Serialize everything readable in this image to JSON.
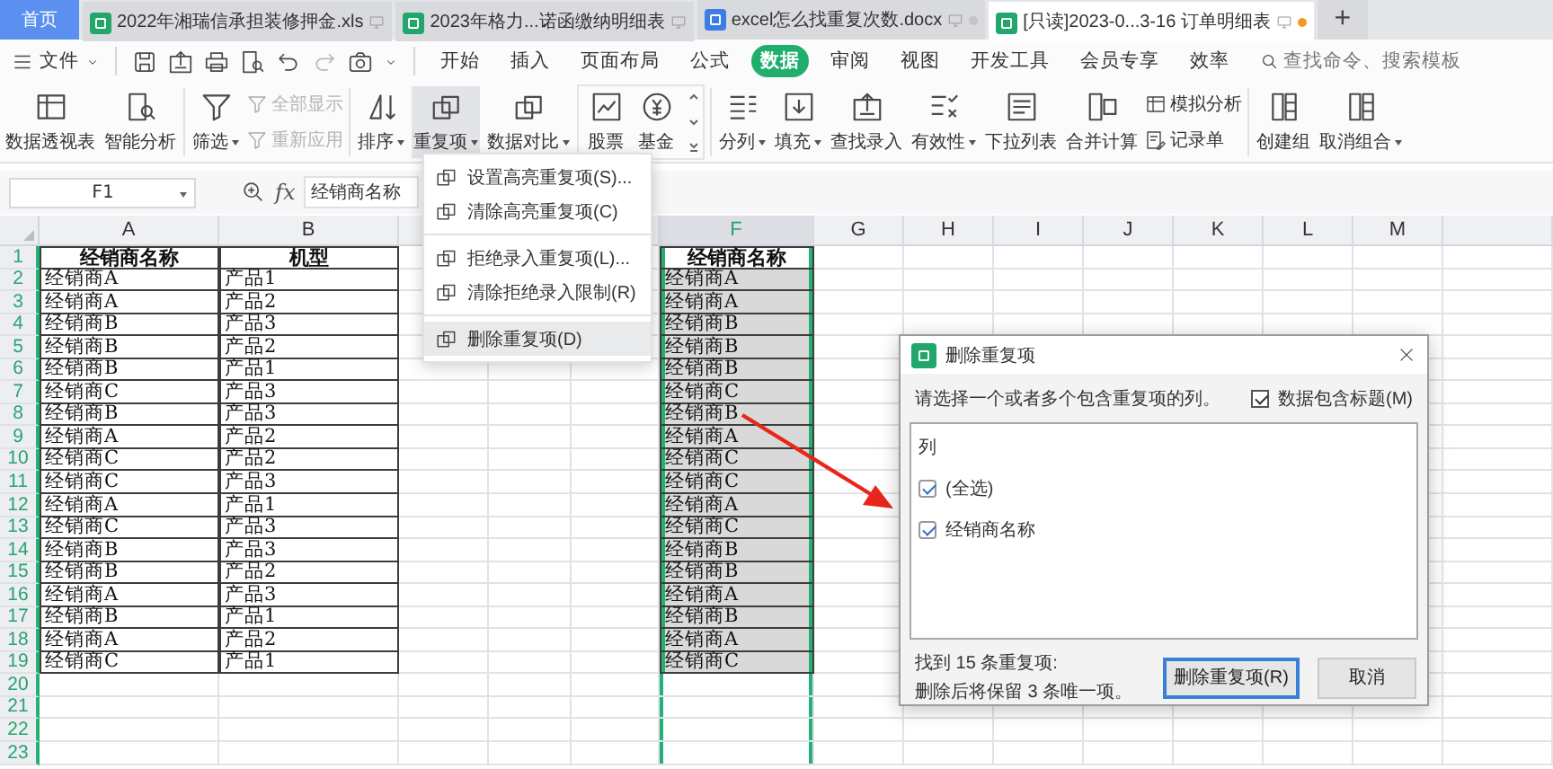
{
  "tabs": [
    {
      "label": "首页",
      "kind": "home",
      "selected": false
    },
    {
      "label": "2022年湘瑞信承担装修押金.xls",
      "kind": "sheet",
      "selected": false
    },
    {
      "label": "2023年格力...诺函缴纳明细表",
      "kind": "sheet",
      "selected": false
    },
    {
      "label": "excel怎么找重复次数.docx",
      "kind": "doc",
      "selected": false,
      "modified": false
    },
    {
      "label": "[只读]2023-0...3-16 订单明细表",
      "kind": "sheet",
      "selected": true,
      "modified": true
    }
  ],
  "new_tab": "+",
  "menu": {
    "file": "文件",
    "items": [
      {
        "label": "开始",
        "selected": false
      },
      {
        "label": "插入",
        "selected": false
      },
      {
        "label": "页面布局",
        "selected": false
      },
      {
        "label": "公式",
        "selected": false
      },
      {
        "label": "数据",
        "selected": true
      },
      {
        "label": "审阅",
        "selected": false
      },
      {
        "label": "视图",
        "selected": false
      },
      {
        "label": "开发工具",
        "selected": false
      },
      {
        "label": "会员专享",
        "selected": false
      },
      {
        "label": "效率",
        "selected": false
      }
    ],
    "search": {
      "placeholder": "查找命令、搜索模板"
    }
  },
  "ribbon": [
    {
      "items": [
        {
          "kind": "large",
          "label": "数据透视表",
          "dropdown": false,
          "pressed": false
        },
        {
          "kind": "large",
          "label": "智能分析",
          "dropdown": false,
          "pressed": false
        }
      ]
    },
    {
      "items": [
        {
          "kind": "large",
          "label": "筛选",
          "dropdown": true,
          "pressed": false
        },
        {
          "kind": "stack",
          "items": [
            {
              "label": "全部显示",
              "disabled": true
            },
            {
              "label": "重新应用",
              "disabled": true
            }
          ]
        }
      ]
    },
    {
      "items": [
        {
          "kind": "large",
          "label": "排序",
          "dropdown": true,
          "pressed": false
        },
        {
          "kind": "large",
          "label": "重复项",
          "dropdown": true,
          "pressed": true
        },
        {
          "kind": "large",
          "label": "数据对比",
          "dropdown": true,
          "pressed": false
        },
        {
          "kind": "gallery",
          "items": [
            {
              "label": "股票"
            },
            {
              "label": "基金"
            }
          ]
        }
      ]
    },
    {
      "items": [
        {
          "kind": "large",
          "label": "分列",
          "dropdown": true,
          "pressed": false
        },
        {
          "kind": "large",
          "label": "填充",
          "dropdown": true,
          "pressed": false
        },
        {
          "kind": "large",
          "label": "查找录入",
          "dropdown": false,
          "pressed": false
        },
        {
          "kind": "large",
          "label": "有效性",
          "dropdown": true,
          "pressed": false
        },
        {
          "kind": "large",
          "label": "下拉列表",
          "dropdown": false,
          "pressed": false
        },
        {
          "kind": "large",
          "label": "合并计算",
          "dropdown": false,
          "pressed": false
        },
        {
          "kind": "stack",
          "items": [
            {
              "label": "模拟分析",
              "disabled": false
            },
            {
              "label": "记录单",
              "disabled": false
            }
          ]
        }
      ]
    },
    {
      "items": [
        {
          "kind": "large",
          "label": "创建组",
          "dropdown": false,
          "pressed": false
        },
        {
          "kind": "large",
          "label": "取消组合",
          "dropdown": true,
          "pressed": false
        }
      ]
    }
  ],
  "formula_bar": {
    "cell": "F1",
    "function_label": "fx",
    "value": "经销商名称"
  },
  "sheet": {
    "columns": [
      {
        "label": "A",
        "selected": false
      },
      {
        "label": "B",
        "selected": false
      },
      {
        "label": "F",
        "selected": true
      },
      {
        "label": "G",
        "selected": false
      },
      {
        "label": "H",
        "selected": false
      },
      {
        "label": "I",
        "selected": false
      },
      {
        "label": "J",
        "selected": false
      },
      {
        "label": "K",
        "selected": false
      },
      {
        "label": "L",
        "selected": false
      },
      {
        "label": "M",
        "selected": false
      }
    ],
    "rows": [
      {
        "number": "1",
        "kind": "header",
        "cells": {
          "A": "经销商名称",
          "B": "机型",
          "F": "经销商名称"
        }
      },
      {
        "number": "2",
        "cells": {
          "A": "经销商A",
          "B": "产品1",
          "F": "经销商A"
        }
      },
      {
        "number": "3",
        "cells": {
          "A": "经销商A",
          "B": "产品2",
          "F": "经销商A"
        }
      },
      {
        "number": "4",
        "cells": {
          "A": "经销商B",
          "B": "产品3",
          "F": "经销商B"
        }
      },
      {
        "number": "5",
        "cells": {
          "A": "经销商B",
          "B": "产品2",
          "F": "经销商B"
        }
      },
      {
        "number": "6",
        "cells": {
          "A": "经销商B",
          "B": "产品1",
          "F": "经销商B"
        }
      },
      {
        "number": "7",
        "cells": {
          "A": "经销商C",
          "B": "产品3",
          "F": "经销商C"
        }
      },
      {
        "number": "8",
        "cells": {
          "A": "经销商B",
          "B": "产品3",
          "F": "经销商B"
        }
      },
      {
        "number": "9",
        "cells": {
          "A": "经销商A",
          "B": "产品2",
          "F": "经销商A"
        }
      },
      {
        "number": "10",
        "cells": {
          "A": "经销商C",
          "B": "产品2",
          "F": "经销商C"
        }
      },
      {
        "number": "11",
        "cells": {
          "A": "经销商C",
          "B": "产品3",
          "F": "经销商C"
        }
      },
      {
        "number": "12",
        "cells": {
          "A": "经销商A",
          "B": "产品1",
          "F": "经销商A"
        }
      },
      {
        "number": "13",
        "cells": {
          "A": "经销商C",
          "B": "产品3",
          "F": "经销商C"
        }
      },
      {
        "number": "14",
        "cells": {
          "A": "经销商B",
          "B": "产品3",
          "F": "经销商B"
        }
      },
      {
        "number": "15",
        "cells": {
          "A": "经销商B",
          "B": "产品2",
          "F": "经销商B"
        }
      },
      {
        "number": "16",
        "cells": {
          "A": "经销商A",
          "B": "产品3",
          "F": "经销商A"
        }
      },
      {
        "number": "17",
        "cells": {
          "A": "经销商B",
          "B": "产品1",
          "F": "经销商B"
        }
      },
      {
        "number": "18",
        "cells": {
          "A": "经销商A",
          "B": "产品2",
          "F": "经销商A"
        }
      },
      {
        "number": "19",
        "cells": {
          "A": "经销商C",
          "B": "产品1",
          "F": "经销商C"
        }
      },
      {
        "number": "20"
      },
      {
        "number": "21"
      },
      {
        "number": "22"
      },
      {
        "number": "23"
      }
    ]
  },
  "dropdown_menu": {
    "groups": [
      [
        {
          "label": "设置高亮重复项(S)...",
          "selected": false
        },
        {
          "label": "清除高亮重复项(C)",
          "selected": false
        }
      ],
      [
        {
          "label": "拒绝录入重复项(L)...",
          "selected": false
        },
        {
          "label": "清除拒绝录入限制(R)",
          "selected": false
        }
      ],
      [
        {
          "label": "删除重复项(D)",
          "selected": true
        }
      ]
    ]
  },
  "dialog": {
    "title": "删除重复项",
    "prompt": "请选择一个或者多个包含重复项的列。",
    "header_checkbox": {
      "label": "数据包含标题(M)",
      "checked": true
    },
    "list": {
      "heading": "列",
      "items": [
        {
          "label": "(全选)",
          "checked": true
        },
        {
          "label": "经销商名称",
          "checked": true
        }
      ]
    },
    "summary": [
      "找到 15 条重复项:",
      "删除后将保留 3 条唯一项。"
    ],
    "buttons": [
      {
        "label": "删除重复项(R)",
        "default": true
      },
      {
        "label": "取消",
        "default": false
      }
    ]
  }
}
